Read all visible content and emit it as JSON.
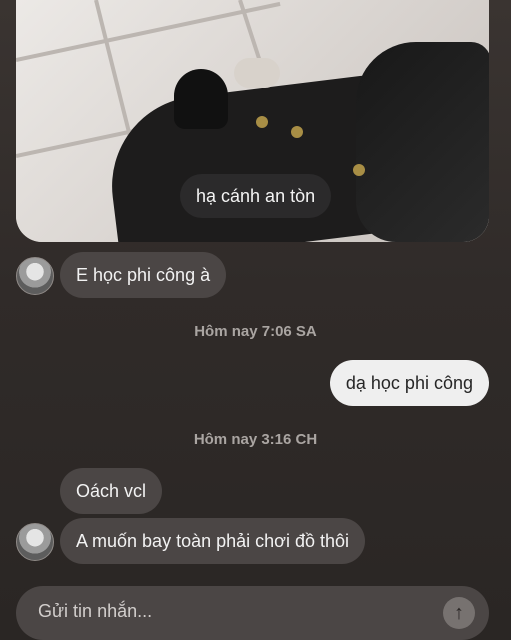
{
  "story": {
    "caption": "hạ cánh an tòn"
  },
  "messages": {
    "first_received": "E học phi công à",
    "time1": "Hôm nay 7:06 SA",
    "sent_reply": "dạ học phi công",
    "time2": "Hôm nay 3:16 CH",
    "second_received": "Oách vcl",
    "third_received": "A muốn bay toàn phải chơi đồ thôi"
  },
  "composer": {
    "placeholder": "Gửi tin nhắn...",
    "send_icon": "↑"
  },
  "icons": {
    "avatar": "avatar-icon",
    "send": "arrow-up-icon"
  },
  "colors": {
    "background": "#2f2a27",
    "received_bubble": "#4b4645",
    "sent_bubble": "#efefef",
    "caption_bg": "#2b2a2b"
  }
}
